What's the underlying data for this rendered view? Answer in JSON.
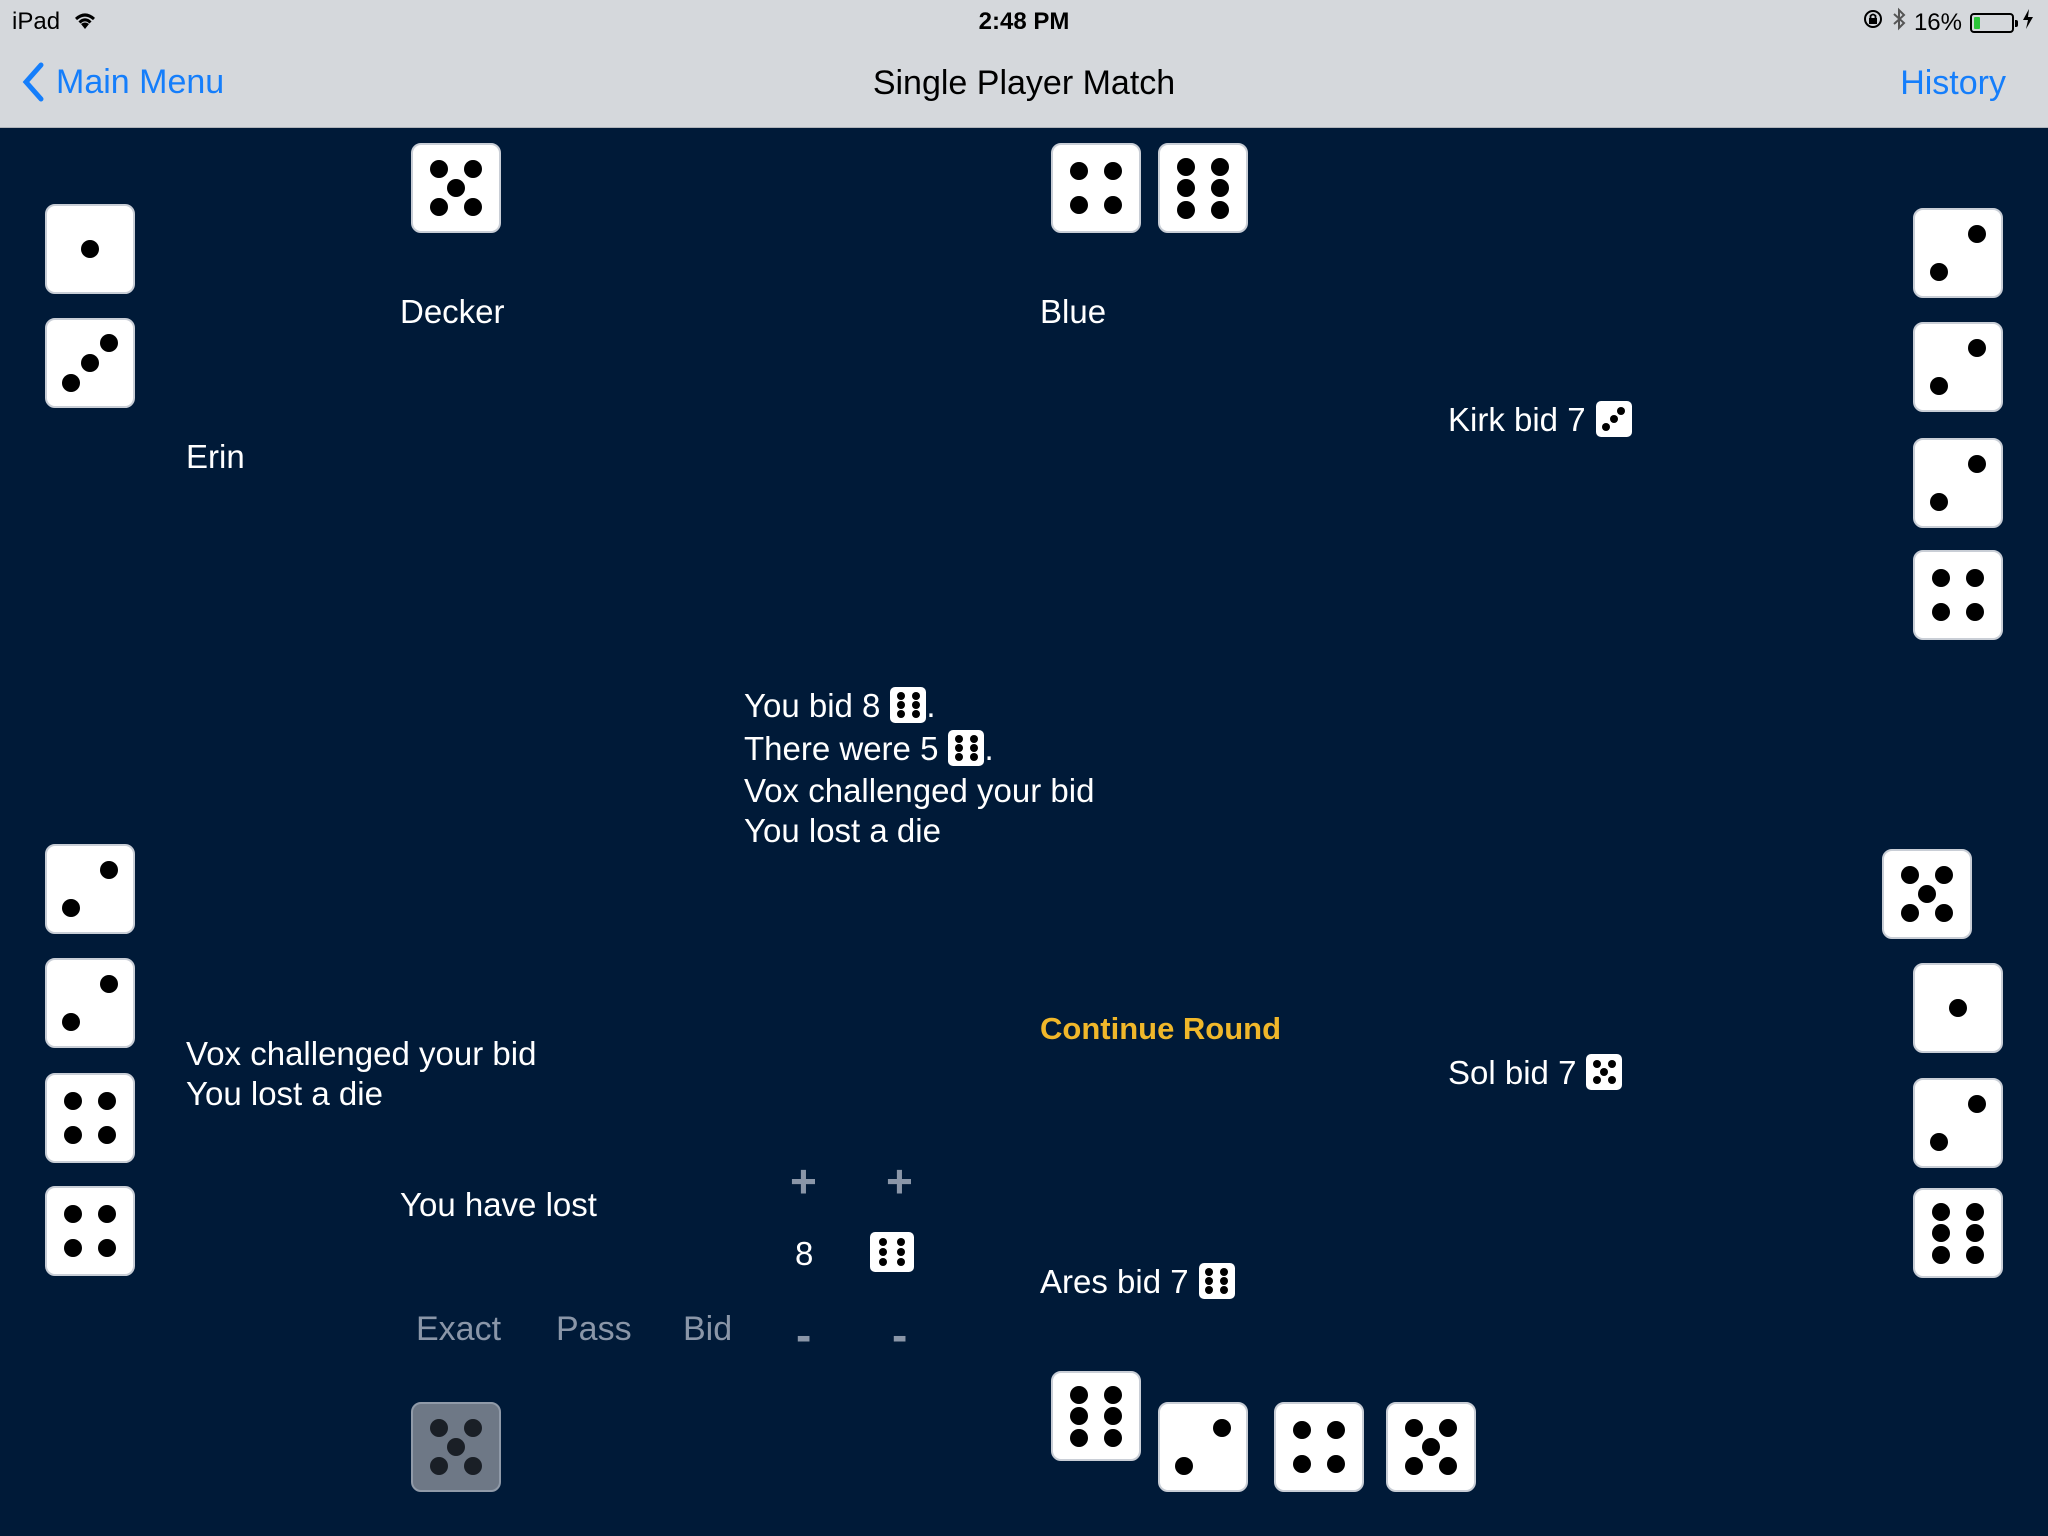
{
  "status_bar": {
    "device": "iPad",
    "time": "2:48 PM",
    "battery": "16%",
    "battery_level": 0.16
  },
  "nav": {
    "back_label": "Main Menu",
    "title": "Single Player Match",
    "right_label": "History"
  },
  "players": {
    "decker": {
      "name": "Decker"
    },
    "blue": {
      "name": "Blue"
    },
    "erin": {
      "name": "Erin"
    }
  },
  "bids": {
    "kirk": {
      "text": "Kirk bid 7",
      "face": 3
    },
    "sol": {
      "text": "Sol bid 7",
      "face": 5
    },
    "ares": {
      "text": "Ares bid 7",
      "face": 6
    }
  },
  "center_log": {
    "line1": "You bid 8",
    "line1_face": 6,
    "line1_end": ".",
    "line2": "There were 5",
    "line2_face": 6,
    "line2_end": ".",
    "line3": "Vox challenged your bid",
    "line4": "You lost a die"
  },
  "left_log": {
    "line1": "Vox challenged your bid",
    "line2": "You lost a die"
  },
  "status": {
    "you_have_lost": "You have lost",
    "continue_label": "Continue Round"
  },
  "controls": {
    "exact": "Exact",
    "pass": "Pass",
    "bid": "Bid",
    "plus": "+",
    "minus": "-",
    "quantity": "8",
    "face": 6
  },
  "dice": {
    "decker": [
      5
    ],
    "blue": [
      4,
      6
    ],
    "erin": [
      1,
      3
    ],
    "kirk": [
      2,
      2,
      2,
      4
    ],
    "vox": [
      2,
      2,
      4,
      4
    ],
    "sol": [
      5,
      1,
      2,
      6
    ],
    "you_gray": [
      5
    ],
    "bottom": [
      6,
      2,
      4,
      5
    ]
  }
}
